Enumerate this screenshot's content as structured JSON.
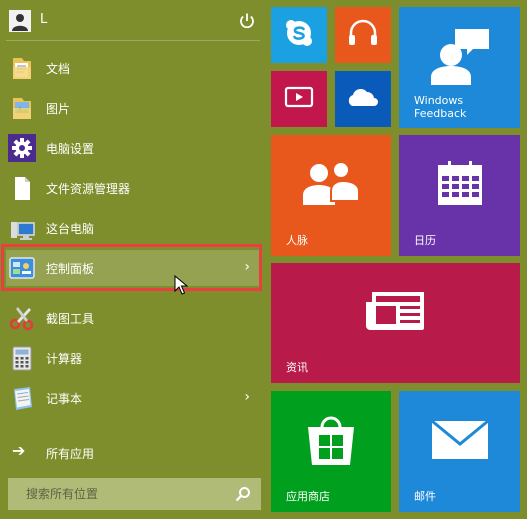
{
  "user": {
    "name": "L",
    "power_icon": "power-icon"
  },
  "menu": {
    "items": [
      {
        "label": "文档",
        "icon": "documents-folder-icon",
        "chevron": ""
      },
      {
        "label": "图片",
        "icon": "pictures-folder-icon",
        "chevron": ""
      },
      {
        "label": "电脑设置",
        "icon": "settings-gear-icon",
        "chevron": ""
      },
      {
        "label": "文件资源管理器",
        "icon": "file-explorer-icon",
        "chevron": ""
      },
      {
        "label": "这台电脑",
        "icon": "this-pc-icon",
        "chevron": ""
      },
      {
        "label": "控制面板",
        "icon": "control-panel-icon",
        "chevron": "›"
      },
      {
        "label": "截图工具",
        "icon": "snipping-tool-icon",
        "chevron": ""
      },
      {
        "label": "计算器",
        "icon": "calculator-icon",
        "chevron": ""
      },
      {
        "label": "记事本",
        "icon": "notepad-icon",
        "chevron": "›"
      }
    ],
    "all_apps": {
      "arrow": "➔",
      "label": "所有应用"
    }
  },
  "search": {
    "placeholder": "搜索所有位置",
    "icon": "search-icon"
  },
  "tiles": {
    "skype": {
      "label": "",
      "color": "#1ba1e2"
    },
    "music": {
      "label": "",
      "color": "#e8571b"
    },
    "video": {
      "label": "",
      "color": "#c1174c"
    },
    "onedrive": {
      "label": "",
      "color": "#0a5ab9"
    },
    "windows_feedback": {
      "label_line1": "Windows",
      "label_line2": "Feedback",
      "color": "#1e89d8"
    },
    "people": {
      "label": "人脉",
      "color": "#e8571b"
    },
    "calendar": {
      "label": "日历",
      "color": "#6832a8"
    },
    "news": {
      "label": "资讯",
      "color": "#b81a4a"
    },
    "store": {
      "label": "应用商店",
      "color": "#00a01e"
    },
    "mail": {
      "label": "邮件",
      "color": "#1e89d8"
    }
  },
  "colors": {
    "background": "#7e8e2c",
    "highlight_border": "#e84040"
  }
}
